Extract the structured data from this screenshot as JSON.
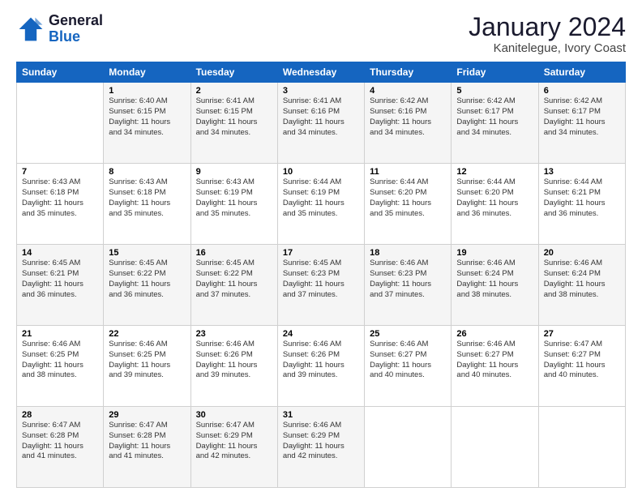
{
  "header": {
    "logo_line1": "General",
    "logo_line2": "Blue",
    "title": "January 2024",
    "subtitle": "Kanitelegue, Ivory Coast"
  },
  "days_of_week": [
    "Sunday",
    "Monday",
    "Tuesday",
    "Wednesday",
    "Thursday",
    "Friday",
    "Saturday"
  ],
  "weeks": [
    [
      {
        "day": "",
        "info": ""
      },
      {
        "day": "1",
        "info": "Sunrise: 6:40 AM\nSunset: 6:15 PM\nDaylight: 11 hours\nand 34 minutes."
      },
      {
        "day": "2",
        "info": "Sunrise: 6:41 AM\nSunset: 6:15 PM\nDaylight: 11 hours\nand 34 minutes."
      },
      {
        "day": "3",
        "info": "Sunrise: 6:41 AM\nSunset: 6:16 PM\nDaylight: 11 hours\nand 34 minutes."
      },
      {
        "day": "4",
        "info": "Sunrise: 6:42 AM\nSunset: 6:16 PM\nDaylight: 11 hours\nand 34 minutes."
      },
      {
        "day": "5",
        "info": "Sunrise: 6:42 AM\nSunset: 6:17 PM\nDaylight: 11 hours\nand 34 minutes."
      },
      {
        "day": "6",
        "info": "Sunrise: 6:42 AM\nSunset: 6:17 PM\nDaylight: 11 hours\nand 34 minutes."
      }
    ],
    [
      {
        "day": "7",
        "info": "Sunrise: 6:43 AM\nSunset: 6:18 PM\nDaylight: 11 hours\nand 35 minutes."
      },
      {
        "day": "8",
        "info": "Sunrise: 6:43 AM\nSunset: 6:18 PM\nDaylight: 11 hours\nand 35 minutes."
      },
      {
        "day": "9",
        "info": "Sunrise: 6:43 AM\nSunset: 6:19 PM\nDaylight: 11 hours\nand 35 minutes."
      },
      {
        "day": "10",
        "info": "Sunrise: 6:44 AM\nSunset: 6:19 PM\nDaylight: 11 hours\nand 35 minutes."
      },
      {
        "day": "11",
        "info": "Sunrise: 6:44 AM\nSunset: 6:20 PM\nDaylight: 11 hours\nand 35 minutes."
      },
      {
        "day": "12",
        "info": "Sunrise: 6:44 AM\nSunset: 6:20 PM\nDaylight: 11 hours\nand 36 minutes."
      },
      {
        "day": "13",
        "info": "Sunrise: 6:44 AM\nSunset: 6:21 PM\nDaylight: 11 hours\nand 36 minutes."
      }
    ],
    [
      {
        "day": "14",
        "info": "Sunrise: 6:45 AM\nSunset: 6:21 PM\nDaylight: 11 hours\nand 36 minutes."
      },
      {
        "day": "15",
        "info": "Sunrise: 6:45 AM\nSunset: 6:22 PM\nDaylight: 11 hours\nand 36 minutes."
      },
      {
        "day": "16",
        "info": "Sunrise: 6:45 AM\nSunset: 6:22 PM\nDaylight: 11 hours\nand 37 minutes."
      },
      {
        "day": "17",
        "info": "Sunrise: 6:45 AM\nSunset: 6:23 PM\nDaylight: 11 hours\nand 37 minutes."
      },
      {
        "day": "18",
        "info": "Sunrise: 6:46 AM\nSunset: 6:23 PM\nDaylight: 11 hours\nand 37 minutes."
      },
      {
        "day": "19",
        "info": "Sunrise: 6:46 AM\nSunset: 6:24 PM\nDaylight: 11 hours\nand 38 minutes."
      },
      {
        "day": "20",
        "info": "Sunrise: 6:46 AM\nSunset: 6:24 PM\nDaylight: 11 hours\nand 38 minutes."
      }
    ],
    [
      {
        "day": "21",
        "info": "Sunrise: 6:46 AM\nSunset: 6:25 PM\nDaylight: 11 hours\nand 38 minutes."
      },
      {
        "day": "22",
        "info": "Sunrise: 6:46 AM\nSunset: 6:25 PM\nDaylight: 11 hours\nand 39 minutes."
      },
      {
        "day": "23",
        "info": "Sunrise: 6:46 AM\nSunset: 6:26 PM\nDaylight: 11 hours\nand 39 minutes."
      },
      {
        "day": "24",
        "info": "Sunrise: 6:46 AM\nSunset: 6:26 PM\nDaylight: 11 hours\nand 39 minutes."
      },
      {
        "day": "25",
        "info": "Sunrise: 6:46 AM\nSunset: 6:27 PM\nDaylight: 11 hours\nand 40 minutes."
      },
      {
        "day": "26",
        "info": "Sunrise: 6:46 AM\nSunset: 6:27 PM\nDaylight: 11 hours\nand 40 minutes."
      },
      {
        "day": "27",
        "info": "Sunrise: 6:47 AM\nSunset: 6:27 PM\nDaylight: 11 hours\nand 40 minutes."
      }
    ],
    [
      {
        "day": "28",
        "info": "Sunrise: 6:47 AM\nSunset: 6:28 PM\nDaylight: 11 hours\nand 41 minutes."
      },
      {
        "day": "29",
        "info": "Sunrise: 6:47 AM\nSunset: 6:28 PM\nDaylight: 11 hours\nand 41 minutes."
      },
      {
        "day": "30",
        "info": "Sunrise: 6:47 AM\nSunset: 6:29 PM\nDaylight: 11 hours\nand 42 minutes."
      },
      {
        "day": "31",
        "info": "Sunrise: 6:46 AM\nSunset: 6:29 PM\nDaylight: 11 hours\nand 42 minutes."
      },
      {
        "day": "",
        "info": ""
      },
      {
        "day": "",
        "info": ""
      },
      {
        "day": "",
        "info": ""
      }
    ]
  ]
}
